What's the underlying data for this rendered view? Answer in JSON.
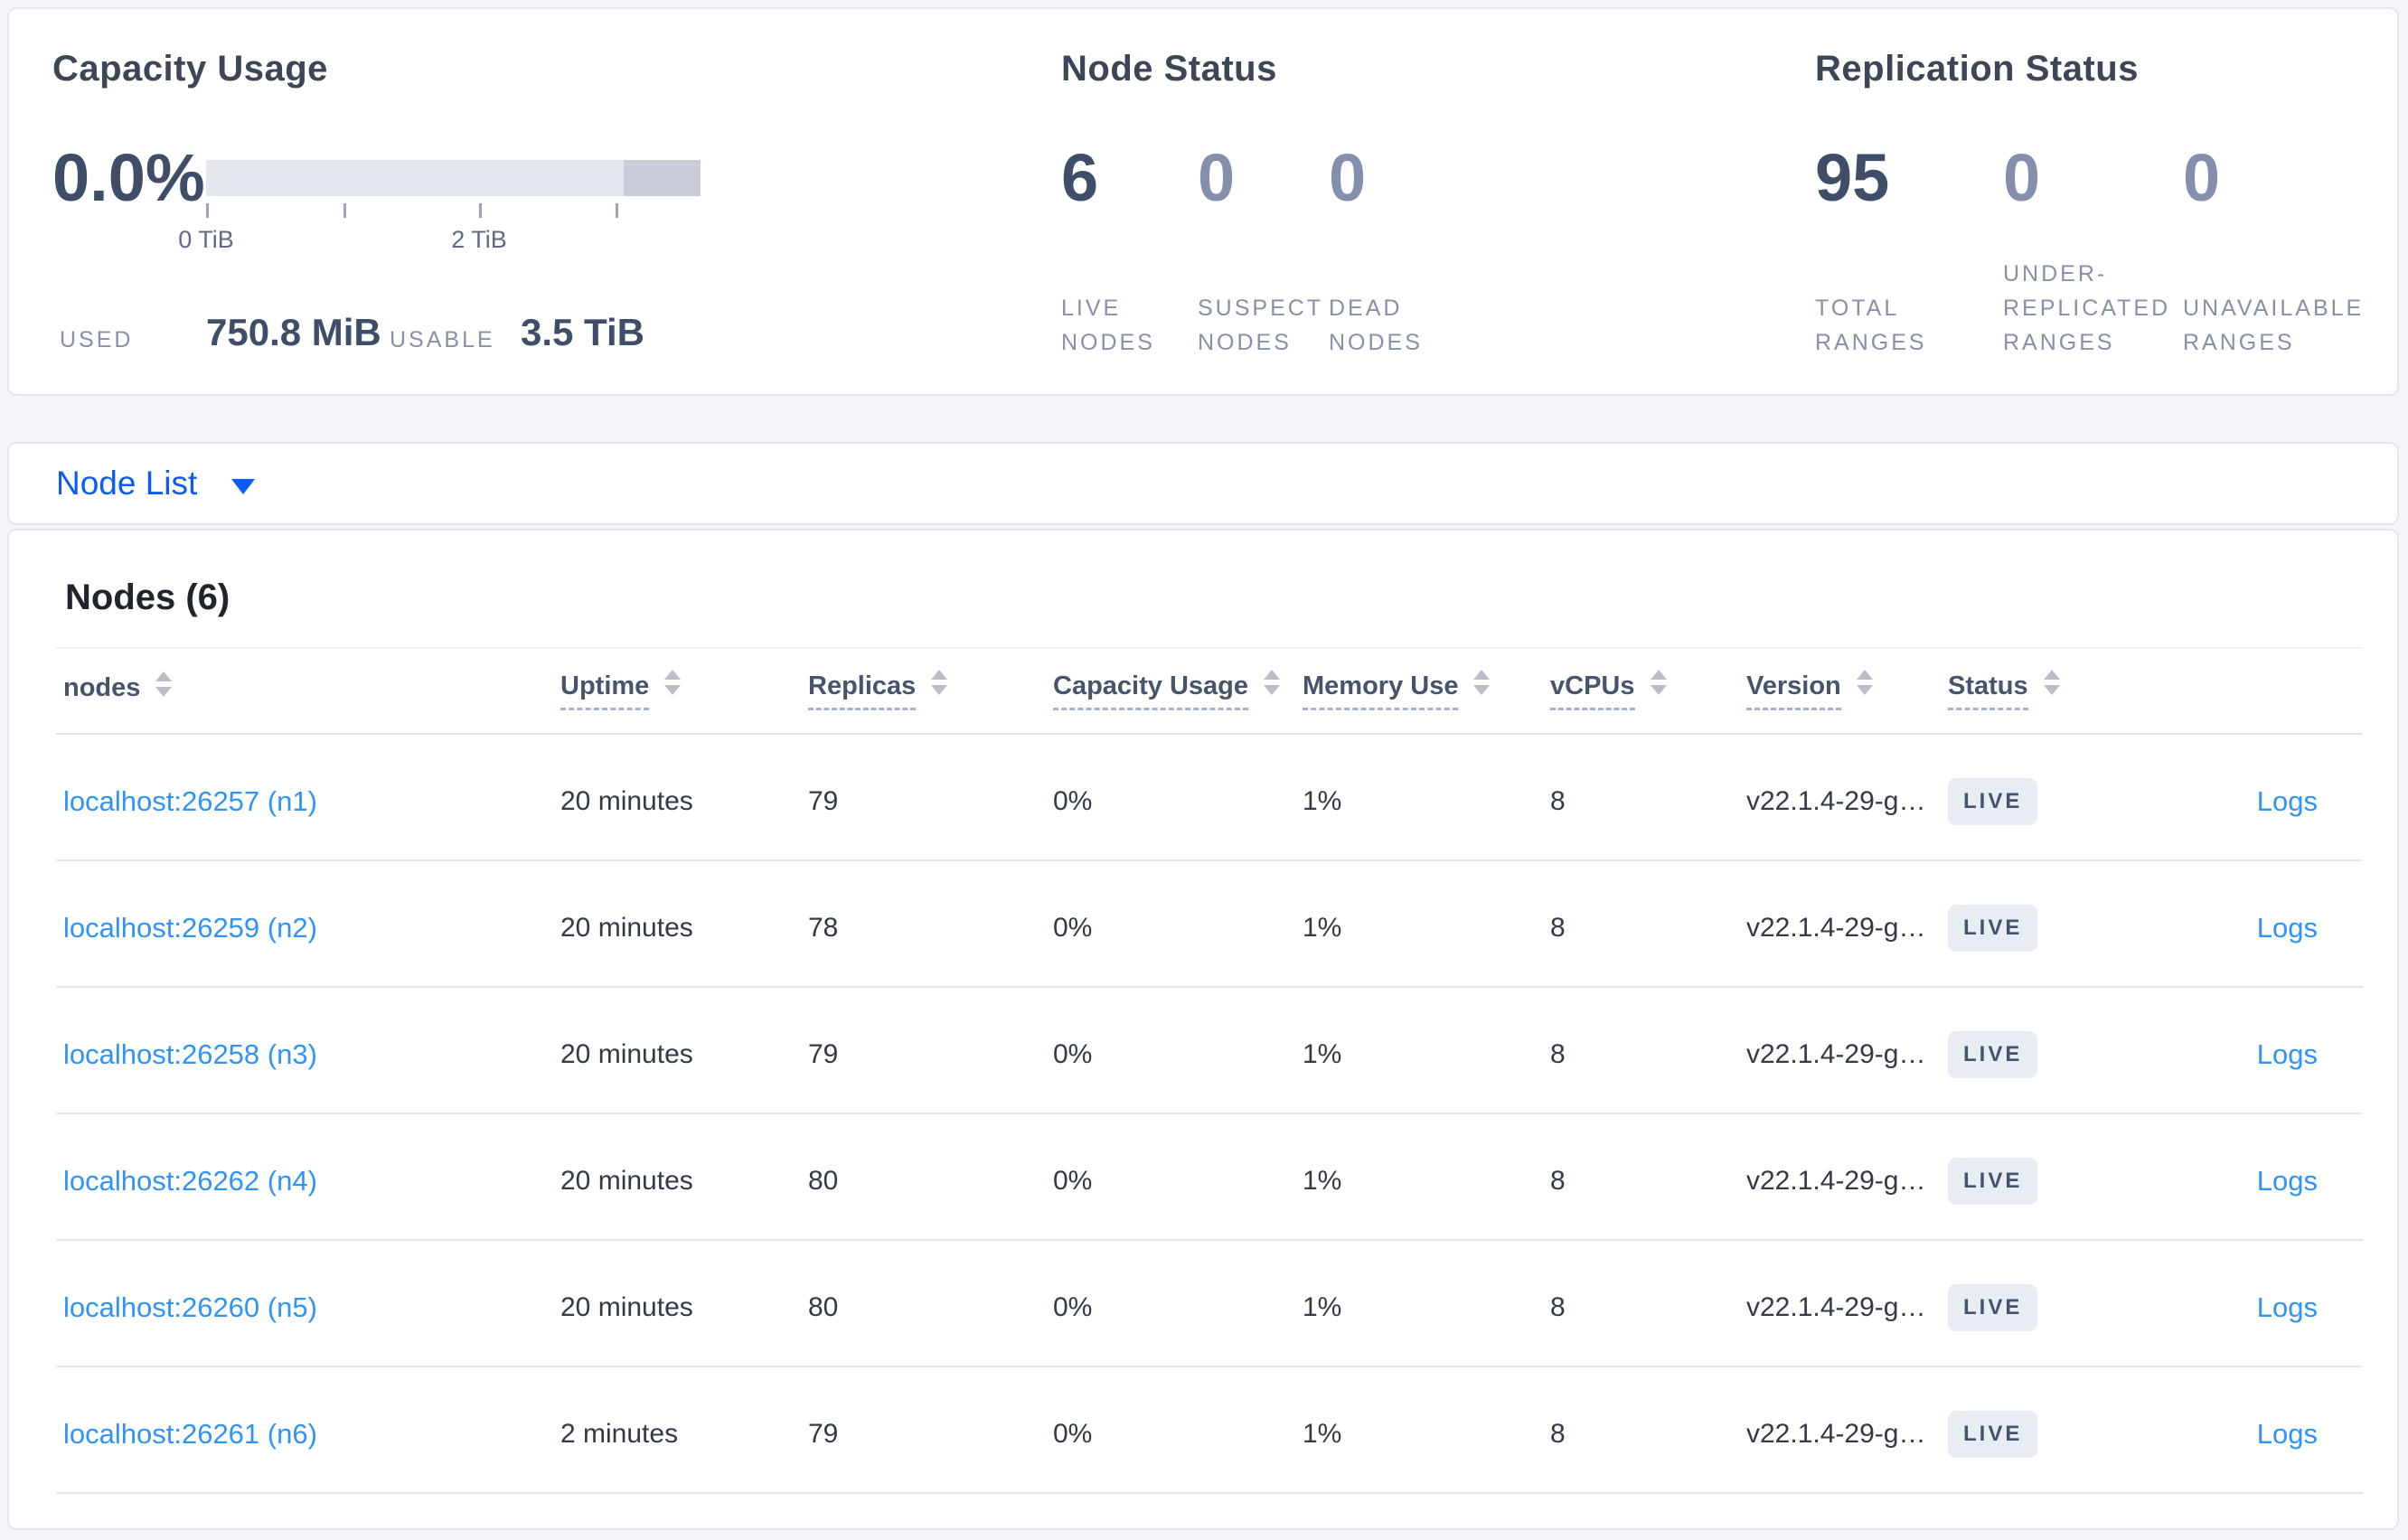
{
  "capacity_usage": {
    "title": "Capacity Usage",
    "percent": "0.0%",
    "tick_labels": [
      "0 TiB",
      "2 TiB"
    ],
    "used_label": "USED",
    "used_value": "750.8 MiB",
    "usable_label": "USABLE",
    "usable_value": "3.5 TiB",
    "bar": {
      "light_color": "#e6e8ef",
      "dark_color": "#c9cdda",
      "dark_fraction": 0.155
    }
  },
  "node_status": {
    "title": "Node Status",
    "stats": [
      {
        "value": "6",
        "label": "LIVE\nNODES"
      },
      {
        "value": "0",
        "label": "SUSPECT\nNODES"
      },
      {
        "value": "0",
        "label": "DEAD\nNODES"
      }
    ]
  },
  "replication_status": {
    "title": "Replication Status",
    "stats": [
      {
        "value": "95",
        "label": "TOTAL\nRANGES"
      },
      {
        "value": "0",
        "label": "UNDER-\nREPLICATED\nRANGES"
      },
      {
        "value": "0",
        "label": "UNAVAILABLE\nRANGES"
      }
    ]
  },
  "node_list": {
    "label": "Node List"
  },
  "nodes_table": {
    "heading": "Nodes (6)",
    "columns": [
      {
        "label": "nodes",
        "underline": false
      },
      {
        "label": "Uptime",
        "underline": true
      },
      {
        "label": "Replicas",
        "underline": true
      },
      {
        "label": "Capacity Usage",
        "underline": true
      },
      {
        "label": "Memory Use",
        "underline": true
      },
      {
        "label": "vCPUs",
        "underline": true
      },
      {
        "label": "Version",
        "underline": true
      },
      {
        "label": "Status",
        "underline": true
      }
    ],
    "logs_label": "Logs",
    "rows": [
      {
        "address": "localhost:26257 (n1)",
        "uptime": "20 minutes",
        "replicas": "79",
        "capacity_usage": "0%",
        "memory_use": "1%",
        "vcpus": "8",
        "version": "v22.1.4-29-g…",
        "status": "LIVE"
      },
      {
        "address": "localhost:26259 (n2)",
        "uptime": "20 minutes",
        "replicas": "78",
        "capacity_usage": "0%",
        "memory_use": "1%",
        "vcpus": "8",
        "version": "v22.1.4-29-g…",
        "status": "LIVE"
      },
      {
        "address": "localhost:26258 (n3)",
        "uptime": "20 minutes",
        "replicas": "79",
        "capacity_usage": "0%",
        "memory_use": "1%",
        "vcpus": "8",
        "version": "v22.1.4-29-g…",
        "status": "LIVE"
      },
      {
        "address": "localhost:26262 (n4)",
        "uptime": "20 minutes",
        "replicas": "80",
        "capacity_usage": "0%",
        "memory_use": "1%",
        "vcpus": "8",
        "version": "v22.1.4-29-g…",
        "status": "LIVE"
      },
      {
        "address": "localhost:26260 (n5)",
        "uptime": "20 minutes",
        "replicas": "80",
        "capacity_usage": "0%",
        "memory_use": "1%",
        "vcpus": "8",
        "version": "v22.1.4-29-g…",
        "status": "LIVE"
      },
      {
        "address": "localhost:26261 (n6)",
        "uptime": "2 minutes",
        "replicas": "79",
        "capacity_usage": "0%",
        "memory_use": "1%",
        "vcpus": "8",
        "version": "v22.1.4-29-g…",
        "status": "LIVE"
      }
    ]
  },
  "colors": {
    "accent_blue": "#0d5bf7",
    "link_blue": "#2f93f7",
    "stat_dark": "#3f4e68",
    "stat_dim": "#8290ae",
    "page_background": "#f4f6fa"
  }
}
